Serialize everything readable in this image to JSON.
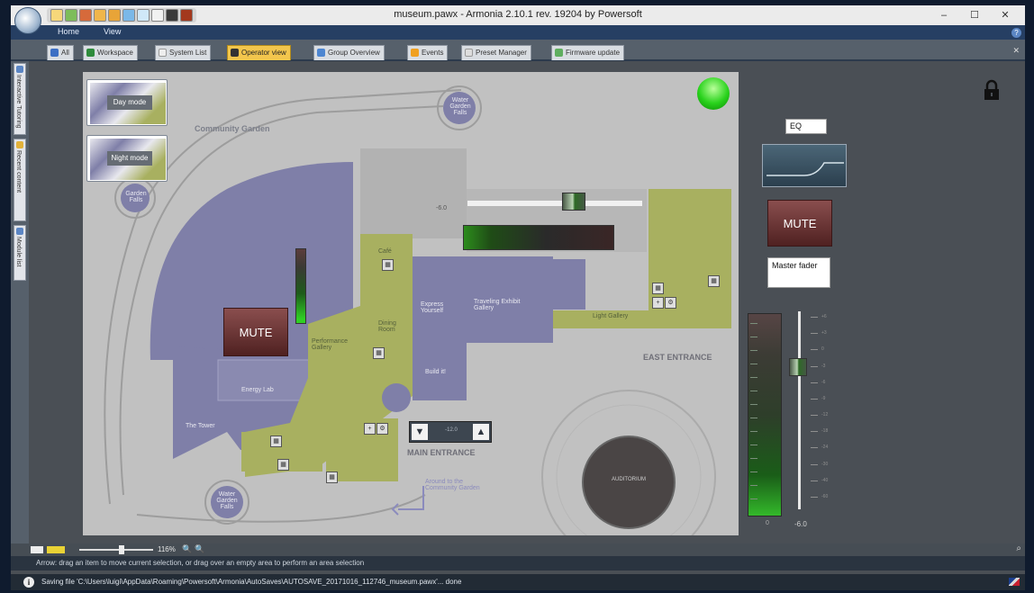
{
  "titlebar": {
    "title": "museum.pawx - Armonia 2.10.1   rev. 19204 by Powersoft",
    "minimize": "–",
    "maximize": "☐",
    "close": "✕"
  },
  "ribbon": {
    "tabs": [
      "Home",
      "View"
    ]
  },
  "doc_tabs": [
    {
      "label": "All",
      "icon_color": "#3c6fc4"
    },
    {
      "label": "Workspace",
      "icon_color": "#2e8b3c"
    },
    {
      "label": "System List",
      "icon_color": "#eeeeee"
    },
    {
      "label": "Operator view",
      "icon_color": "#333333"
    },
    {
      "label": "Group Overview",
      "icon_color": "#4d86d1"
    },
    {
      "label": "Events",
      "icon_color": "#f0a020"
    },
    {
      "label": "Preset Manager",
      "icon_color": "#dddddd"
    },
    {
      "label": "Firmware update",
      "icon_color": "#5fae5f"
    }
  ],
  "doc_tabs_close": "✕",
  "left_tabs": [
    {
      "label": "Interactive Tutoring"
    },
    {
      "label": "Recent content"
    },
    {
      "label": "Module list"
    }
  ],
  "map": {
    "labels": {
      "community_garden": "Community Garden",
      "east_entrance": "EAST ENTRANCE",
      "main_entrance": "MAIN ENTRANCE",
      "light_gallery": "Light Gallery",
      "express_yourself": "Express Yourself",
      "traveling_exhibit": "Traveling Exhibit Gallery",
      "build_it": "Build it!",
      "energy_lab": "Energy Lab",
      "performance_gallery": "Performance Gallery",
      "dining_room": "Dining Room",
      "cafe": "Café",
      "the_tower": "The Tower",
      "water_garden_1": "Water Garden Falls",
      "water_garden_2": "Water Garden Falls",
      "garden_falls": "Garden Falls",
      "around_to_garden": "Around to the Community Garden",
      "round_circle": "AUDITORIUM"
    },
    "presets": [
      {
        "label": "Day mode"
      },
      {
        "label": "Night mode"
      }
    ],
    "mute_label": "MUTE",
    "slider_value": "-6.0",
    "entrance_up": "▲",
    "entrance_down": "▼",
    "entrance_value": "-12.0",
    "status_led_color": "#29d21c"
  },
  "right_panel": {
    "eq_label": "EQ",
    "mute_label": "MUTE",
    "master_fader_label": "Master fader",
    "master_value": "-6.0",
    "master_value_left": "0",
    "fader_level_percent": 72,
    "scale": [
      "+6",
      "+3",
      "0",
      "-3",
      "-6",
      "-9",
      "-12",
      "-18",
      "-24",
      "-30",
      "-40",
      "-60"
    ]
  },
  "zoom": {
    "percent": "116%",
    "zoom_in": "🔍",
    "zoom_out": "🔍"
  },
  "hint": "Arrow: drag an item to move current selection, or drag over an empty area to perform an area selection",
  "status": "Saving file 'C:\\Users\\luigi\\AppData\\Roaming\\Powersoft\\Armonia\\AutoSaves\\AUTOSAVE_20171016_112746_museum.pawx'... done",
  "colors": {
    "accent": "#f3c64d",
    "room_purple": "#7f7fa8",
    "room_green": "#a8b060",
    "led_green": "#29d21c"
  }
}
